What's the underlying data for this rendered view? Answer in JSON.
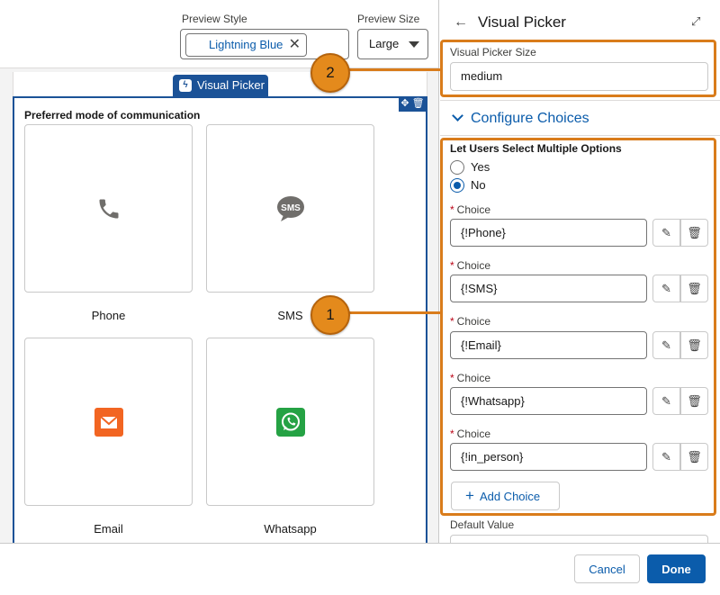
{
  "toolbar": {
    "preview_style_label": "Preview Style",
    "preview_style_value": "Lightning Blue",
    "preview_size_label": "Preview Size",
    "preview_size_value": "Large"
  },
  "canvas": {
    "component_tag": "Visual Picker",
    "component_label": "Preferred mode of communication",
    "cards": [
      {
        "label": "Phone",
        "icon": "phone-icon"
      },
      {
        "label": "SMS",
        "icon": "sms-icon",
        "icon_text": "SMS"
      },
      {
        "label": "Email",
        "icon": "email-icon"
      },
      {
        "label": "Whatsapp",
        "icon": "whatsapp-icon"
      }
    ]
  },
  "panel": {
    "title": "Visual Picker",
    "visual_picker_size_label": "Visual Picker Size",
    "visual_picker_size_value": "medium",
    "configure_section": "Configure Choices",
    "multi_select_label": "Let Users Select Multiple Options",
    "options": [
      {
        "label": "Yes",
        "selected": false
      },
      {
        "label": "No",
        "selected": true
      }
    ],
    "choice_label": "Choice",
    "required_marker": "*",
    "choices": [
      "{!Phone}",
      "{!SMS}",
      "{!Email}",
      "{!Whatsapp}",
      "{!in_person}"
    ],
    "add_choice_label": "Add Choice",
    "default_value_label": "Default Value"
  },
  "footer": {
    "cancel_label": "Cancel",
    "done_label": "Done"
  },
  "callouts": [
    "1",
    "2"
  ],
  "colors": {
    "brand_blue": "#0b5cab",
    "component_blue": "#1b5297",
    "callout_orange": "#e48a1c",
    "email_orange": "#f26522",
    "whatsapp_green": "#25a244",
    "icon_gray": "#706e6b"
  }
}
